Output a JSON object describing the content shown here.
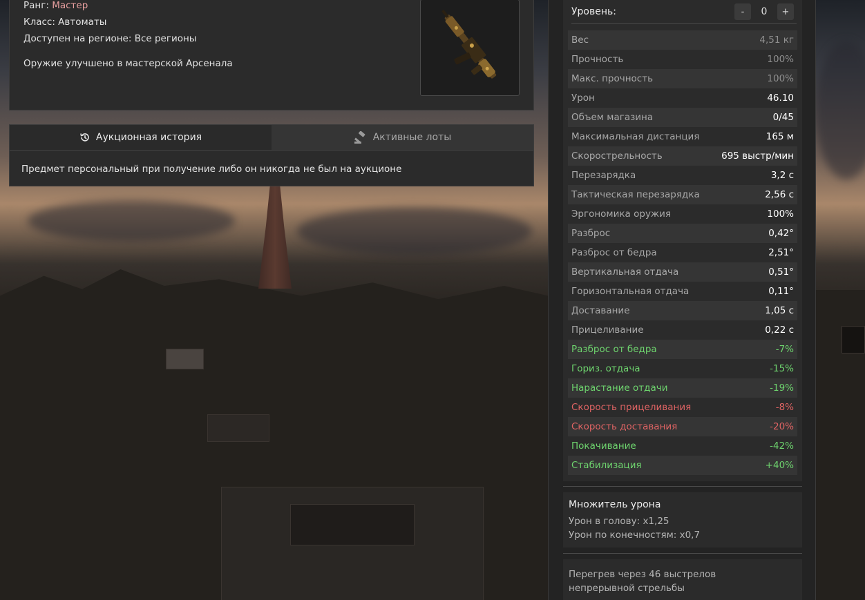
{
  "item_info": {
    "rank_label": "Ранг:",
    "rank_value": "Мастер",
    "class_text": "Класс: Автоматы",
    "region_text": "Доступен на регионе: Все регионы",
    "upgrade_note": "Оружие улучшено в мастерской Арсенала"
  },
  "history": {
    "tabs": [
      {
        "label": "Аукционная история",
        "icon": "history-icon",
        "active": true
      },
      {
        "label": "Активные лоты",
        "icon": "gavel-icon",
        "active": false
      }
    ],
    "message": "Предмет персональный при получение либо он никогда не был на аукционе"
  },
  "level": {
    "label": "Уровень:",
    "minus": "-",
    "value": "0",
    "plus": "+"
  },
  "stats": [
    {
      "name": "Вес",
      "value": "4,51 кг",
      "kind": "dim"
    },
    {
      "name": "Прочность",
      "value": "100%",
      "kind": "dim"
    },
    {
      "name": "Макс. прочность",
      "value": "100%",
      "kind": "dim"
    },
    {
      "name": "Урон",
      "value": "46.10",
      "kind": "normal"
    },
    {
      "name": "Объем магазина",
      "value": "0/45",
      "kind": "normal"
    },
    {
      "name": "Максимальная дистанция",
      "value": "165 м",
      "kind": "normal"
    },
    {
      "name": "Скорострельность",
      "value": "695 выстр/мин",
      "kind": "normal"
    },
    {
      "name": "Перезарядка",
      "value": "3,2 с",
      "kind": "normal"
    },
    {
      "name": "Тактическая перезарядка",
      "value": "2,56 с",
      "kind": "normal"
    },
    {
      "name": "Эргономика оружия",
      "value": "100%",
      "kind": "normal"
    },
    {
      "name": "Разброс",
      "value": "0,42°",
      "kind": "normal"
    },
    {
      "name": "Разброс от бедра",
      "value": "2,51°",
      "kind": "normal"
    },
    {
      "name": "Вертикальная отдача",
      "value": "0,51°",
      "kind": "normal"
    },
    {
      "name": "Горизонтальная отдача",
      "value": "0,11°",
      "kind": "normal"
    },
    {
      "name": "Доставание",
      "value": "1,05 с",
      "kind": "normal"
    },
    {
      "name": "Прицеливание",
      "value": "0,22 с",
      "kind": "normal"
    },
    {
      "name": "Разброс от бедра",
      "value": "-7%",
      "kind": "pos"
    },
    {
      "name": "Гориз. отдача",
      "value": "-15%",
      "kind": "pos"
    },
    {
      "name": "Нарастание отдачи",
      "value": "-19%",
      "kind": "pos"
    },
    {
      "name": "Скорость прицеливания",
      "value": "-8%",
      "kind": "neg"
    },
    {
      "name": "Скорость доставания",
      "value": "-20%",
      "kind": "neg"
    },
    {
      "name": "Покачивание",
      "value": "-42%",
      "kind": "pos"
    },
    {
      "name": "Стабилизация",
      "value": "+40%",
      "kind": "pos"
    }
  ],
  "damage_multiplier": {
    "title": "Множитель урона",
    "head": "Урон в голову: x1,25",
    "limbs": "Урон по конечностям: x0,7"
  },
  "overheat": {
    "line1": "Перегрев через 46 выстрелов",
    "line2": "непрерывной стрельбы"
  },
  "colors": {
    "positive": "#6ed46e",
    "negative": "#e06464",
    "rank": "#e9a0a0"
  }
}
